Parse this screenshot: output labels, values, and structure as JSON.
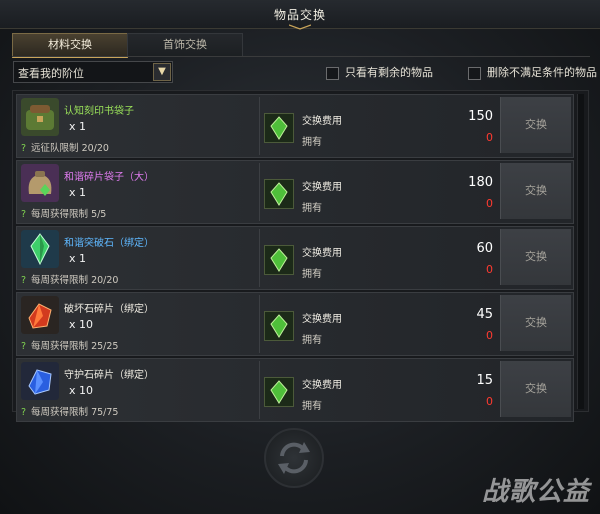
{
  "window": {
    "title": "物品交换"
  },
  "tabs": [
    {
      "label": "材料交换",
      "active": true
    },
    {
      "label": "首饰交换",
      "active": false
    }
  ],
  "filter": {
    "selected": "查看我的阶位"
  },
  "options": [
    {
      "label": "只看有剩余的物品",
      "checked": false
    },
    {
      "label": "删除不满足条件的物品",
      "checked": false
    }
  ],
  "labels": {
    "cost": "交换费用",
    "owned": "拥有",
    "exchange_button": "交换"
  },
  "items": [
    {
      "name": "认知刻印书袋子",
      "name_color": "#9be35a",
      "qty": "x 1",
      "limit": "远征队限制 20/20",
      "cost": "150",
      "owned": "0",
      "icon": "green-satchel-icon"
    },
    {
      "name": "和谐碎片袋子（大）",
      "name_color": "#e07cf0",
      "qty": "x 1",
      "limit": "每周获得限制 5/5",
      "cost": "180",
      "owned": "0",
      "icon": "shard-pouch-icon"
    },
    {
      "name": "和谐突破石（绑定）",
      "name_color": "#5fb8ff",
      "qty": "x 1",
      "limit": "每周获得限制 20/20",
      "cost": "60",
      "owned": "0",
      "icon": "green-crystal-icon"
    },
    {
      "name": "破坏石碎片（绑定）",
      "name_color": "#f1eee4",
      "qty": "x 10",
      "limit": "每周获得限制 25/25",
      "cost": "45",
      "owned": "0",
      "icon": "red-stone-icon"
    },
    {
      "name": "守护石碎片（绑定）",
      "name_color": "#f1eee4",
      "qty": "x 10",
      "limit": "每周获得限制 75/75",
      "cost": "15",
      "owned": "0",
      "icon": "blue-stone-icon"
    }
  ],
  "watermark": "战歌公益",
  "colors": {
    "accent_gold": "#c9a55a",
    "owned_zero": "#ff3a30",
    "limit_mark": "#7fd250"
  }
}
